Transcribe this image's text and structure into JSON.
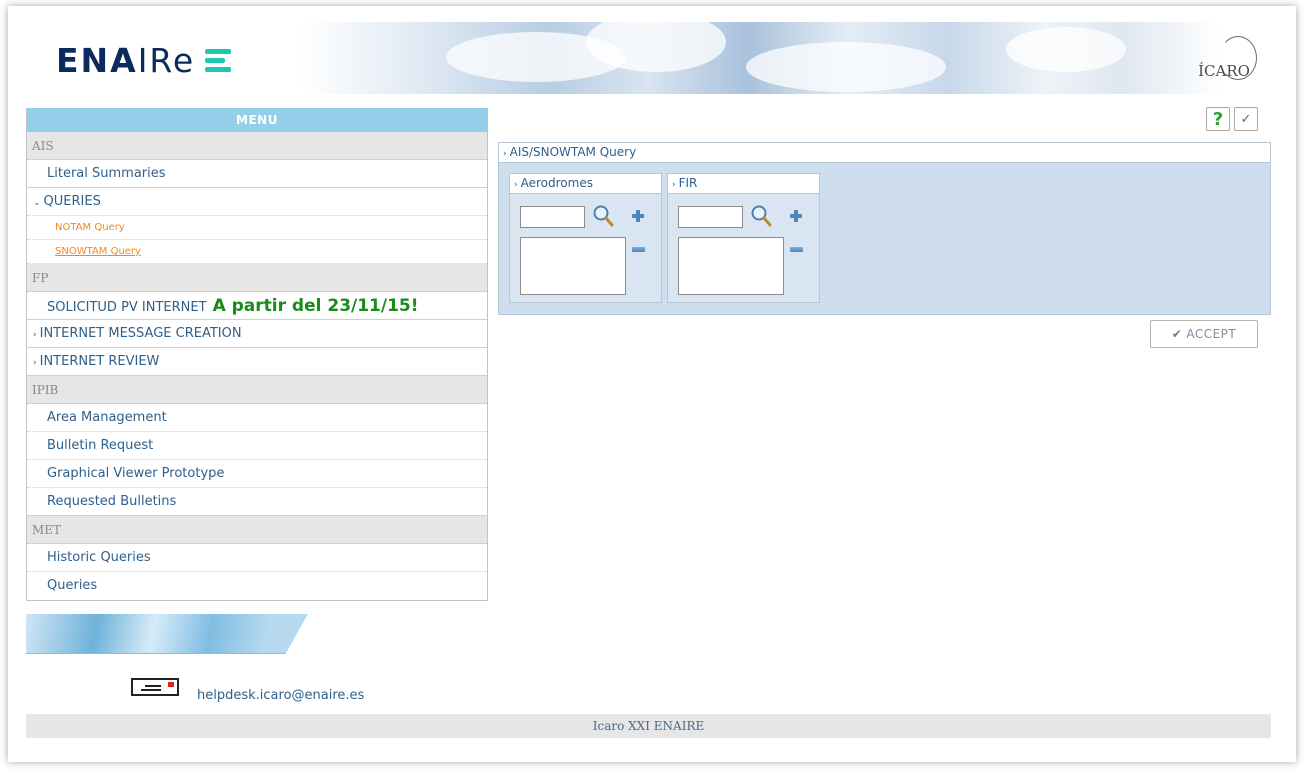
{
  "header": {
    "logo_text_bold": "ENA",
    "logo_text_light": "IRe",
    "icaro_text": "ÍCARO"
  },
  "menu": {
    "title": "MENU",
    "sections": {
      "ais": "AIS",
      "fp": "FP",
      "ipib": "IPIB",
      "met": "MET"
    },
    "ais_items": {
      "literal_summaries": "Literal Summaries",
      "queries": "QUERIES",
      "notam_query": "NOTAM Query",
      "snowtam_query": "SNOWTAM Query"
    },
    "fp_items": {
      "solicitud": "SOLICITUD PV INTERNET",
      "solicitud_highlight": "A partir del 23/11/15!",
      "message_creation": "INTERNET MESSAGE CREATION",
      "review": "INTERNET REVIEW"
    },
    "ipib_items": {
      "area_management": "Area Management",
      "bulletin_request": "Bulletin Request",
      "graphical_viewer": "Graphical Viewer Prototype",
      "requested_bulletins": "Requested Bulletins"
    },
    "met_items": {
      "historic_queries": "Historic Queries",
      "queries": "Queries"
    }
  },
  "toolbar": {
    "help_label": "?",
    "check_label": "✓"
  },
  "query": {
    "title": "AIS/SNOWTAM Query",
    "aerodromes_title": "Aerodromes",
    "fir_title": "FIR",
    "aerodromes_value": "",
    "fir_value": "",
    "accept_label": "ACCEPT"
  },
  "footer": {
    "helpdesk_email": "helpdesk.icaro@enaire.es",
    "footer_text": "Icaro XXI ENAIRE"
  },
  "colors": {
    "menu_title_bg": "#93cfe9",
    "link": "#2f5f8a",
    "submenu": "#f0891e",
    "highlight": "#1a8a1a",
    "query_bg": "#cfdeee"
  }
}
